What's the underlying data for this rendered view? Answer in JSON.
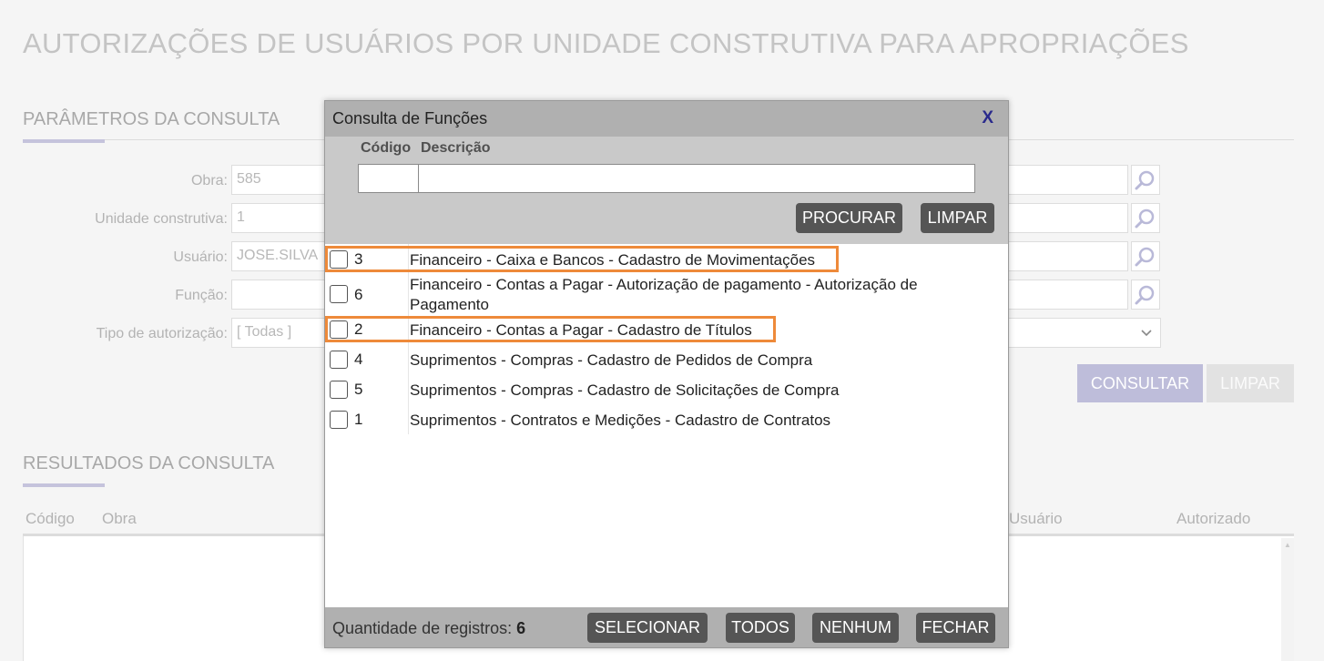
{
  "page": {
    "title": "AUTORIZAÇÕES DE USUÁRIOS POR UNIDADE CONSTRUTIVA PARA APROPRIAÇÕES",
    "params_title": "PARÂMETROS DA CONSULTA",
    "results_title": "RESULTADOS DA CONSULTA"
  },
  "form": {
    "obra_label": "Obra:",
    "obra_value": "585",
    "unidade_label": "Unidade construtiva:",
    "unidade_value": "1",
    "usuario_label": "Usuário:",
    "usuario_value": "JOSE.SILVA",
    "funcao_label": "Função:",
    "funcao_value": "",
    "tipo_label": "Tipo de autorização:",
    "tipo_value": "[ Todas ]",
    "consultar_label": "CONSULTAR",
    "limpar_label": "LIMPAR"
  },
  "results": {
    "columns": [
      "Código",
      "Obra",
      "Usuário",
      "Autorizado"
    ]
  },
  "modal": {
    "title": "Consulta de Funções",
    "close_label": "X",
    "codigo_label": "Código",
    "descricao_label": "Descrição",
    "codigo_value": "",
    "descricao_value": "",
    "procurar_label": "PROCURAR",
    "limpar_label": "LIMPAR",
    "rows": [
      {
        "code": "3",
        "desc": "Financeiro - Caixa e Bancos - Cadastro de Movimentações",
        "highlighted": true
      },
      {
        "code": "6",
        "desc": "Financeiro - Contas a Pagar - Autorização de pagamento - Autorização de Pagamento",
        "highlighted": false
      },
      {
        "code": "2",
        "desc": "Financeiro - Contas a Pagar - Cadastro de Títulos",
        "highlighted": true
      },
      {
        "code": "4",
        "desc": "Suprimentos - Compras - Cadastro de Pedidos de Compra",
        "highlighted": false
      },
      {
        "code": "5",
        "desc": "Suprimentos - Compras - Cadastro de Solicitações de Compra",
        "highlighted": false
      },
      {
        "code": "1",
        "desc": "Suprimentos - Contratos e Medições - Cadastro de Contratos",
        "highlighted": false
      }
    ],
    "count_label": "Quantidade de registros:",
    "count_value": "6",
    "selecionar_label": "SELECIONAR",
    "todos_label": "TODOS",
    "nenhum_label": "NENHUM",
    "fechar_label": "FECHAR"
  },
  "colors": {
    "highlight": "#ee8a3a",
    "accent": "#bebdda",
    "modal_button": "#555555"
  },
  "icons": {
    "lookup": "magnifier-icon",
    "select": "chevron-down-icon"
  }
}
